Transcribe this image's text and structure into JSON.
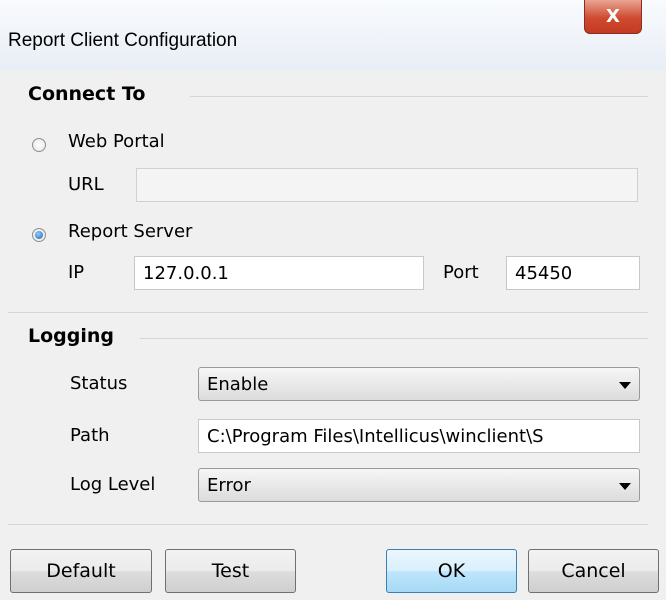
{
  "window": {
    "title": "Report Client Configuration",
    "close_glyph": "X"
  },
  "connect_to": {
    "heading": "Connect To",
    "web_portal": {
      "label": "Web Portal",
      "selected": false,
      "url_label": "URL",
      "url_value": ""
    },
    "report_server": {
      "label": "Report Server",
      "selected": true,
      "ip_label": "IP",
      "ip_value": "127.0.0.1",
      "port_label": "Port",
      "port_value": "45450"
    }
  },
  "logging": {
    "heading": "Logging",
    "status_label": "Status",
    "status_value": "Enable",
    "path_label": "Path",
    "path_value": "C:\\Program Files\\Intellicus\\winclient\\S",
    "level_label": "Log Level",
    "level_value": "Error"
  },
  "buttons": {
    "default": "Default",
    "test": "Test",
    "ok": "OK",
    "cancel": "Cancel"
  }
}
